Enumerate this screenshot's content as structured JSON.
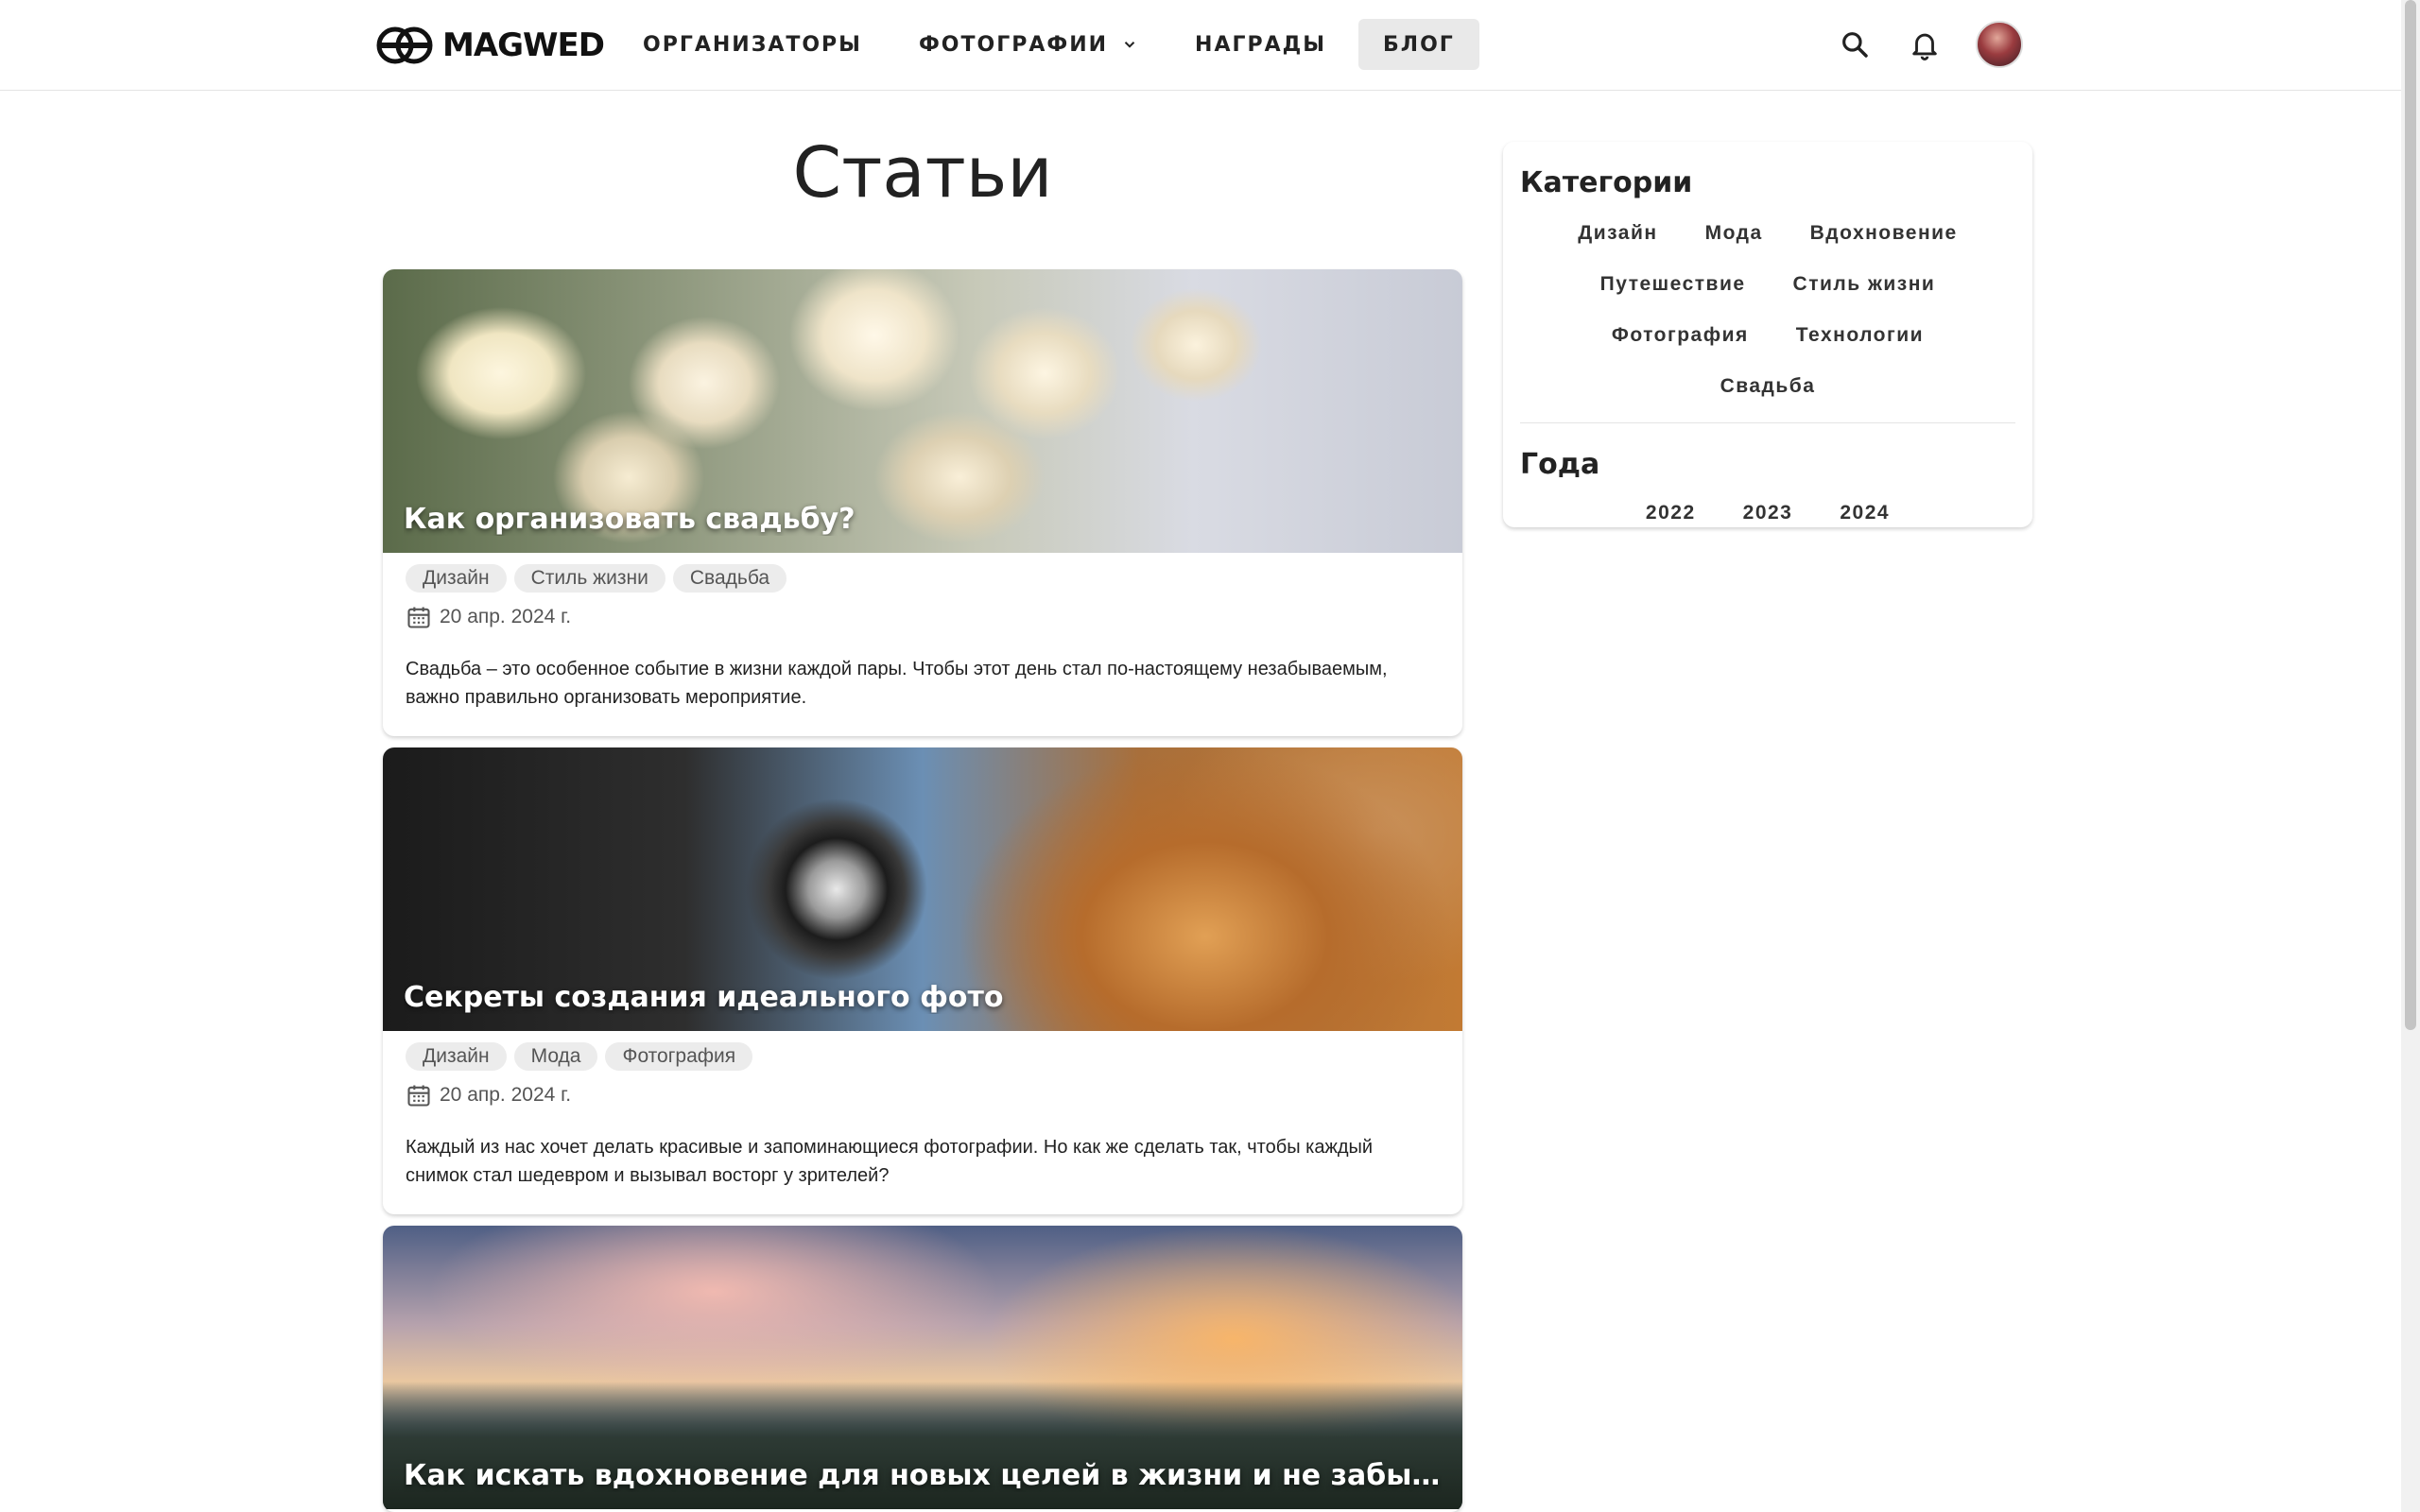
{
  "header": {
    "logo_text": "MAGWED",
    "nav": [
      {
        "label": "ОРГАНИЗАТОРЫ"
      },
      {
        "label": "ФОТОГРАФИИ"
      },
      {
        "label": "НАГРАДЫ"
      },
      {
        "label": "БЛОГ"
      }
    ],
    "active_nav": "БЛОГ"
  },
  "main": {
    "title": "Статьи",
    "articles": [
      {
        "title": "Как организовать свадьбу?",
        "tags": [
          "Дизайн",
          "Стиль жизни",
          "Свадьба"
        ],
        "date": "20 апр. 2024 г.",
        "excerpt": "Свадьба – это особенное событие в жизни каждой пары. Чтобы этот день стал по-настоящему незабываемым, важно правильно организовать мероприятие."
      },
      {
        "title": "Секреты создания идеального фото",
        "tags": [
          "Дизайн",
          "Мода",
          "Фотография"
        ],
        "date": "20 апр. 2024 г.",
        "excerpt": "Каждый из нас хочет делать красивые и запоминающиеся фотографии. Но как же сделать так, чтобы каждый снимок стал шедевром и вызывал восторг у зрителей?"
      },
      {
        "title": "Как искать вдохновение для новых целей в жизни и не забывать давать ..."
      }
    ]
  },
  "sidebar": {
    "categories_title": "Категории",
    "categories": [
      "Дизайн",
      "Мода",
      "Вдохновение",
      "Путешествие",
      "Стиль жизни",
      "Фотография",
      "Технологии",
      "Свадьба"
    ],
    "years_title": "Года",
    "years": [
      "2022",
      "2023",
      "2024"
    ]
  }
}
